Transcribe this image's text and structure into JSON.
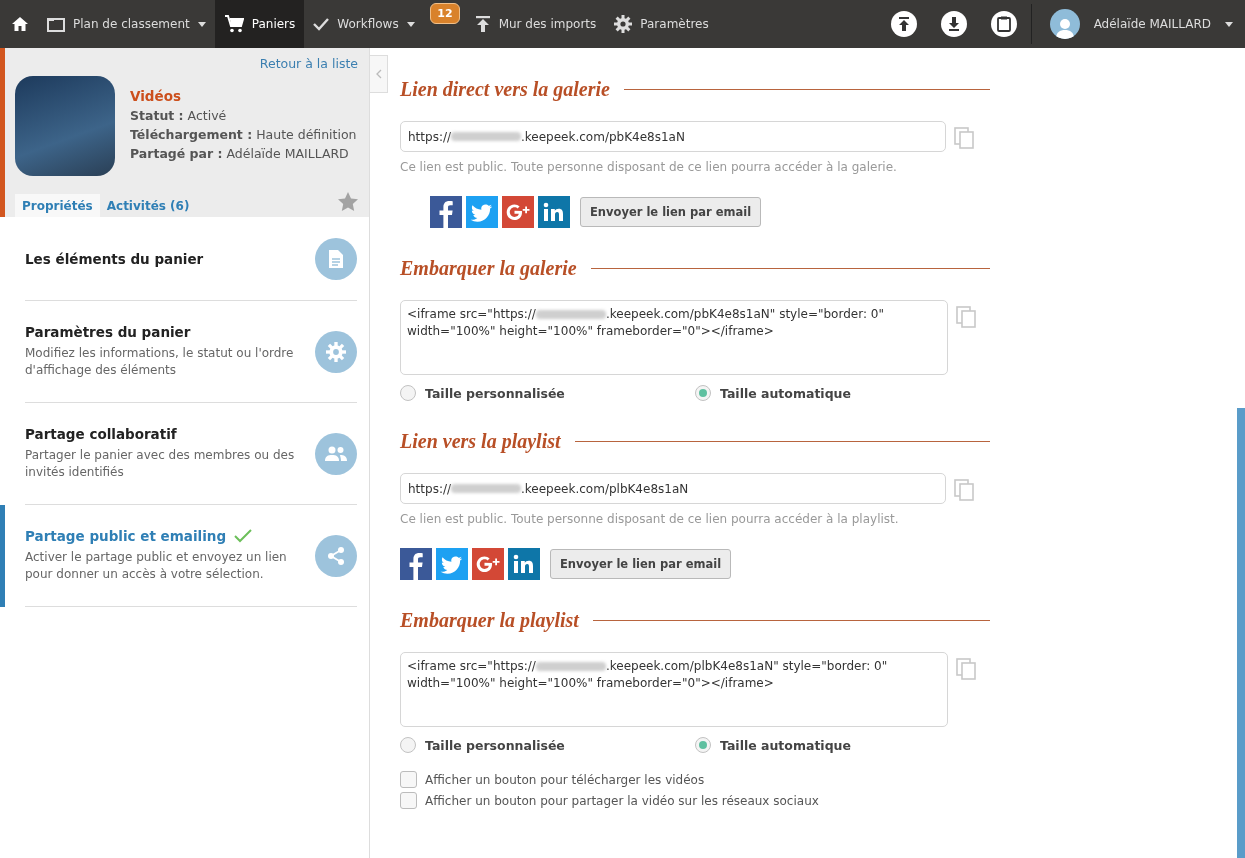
{
  "topbar": {
    "nav": [
      {
        "selected": false
      },
      {
        "label": "Plan de classement",
        "dropdown": true,
        "selected": false
      },
      {
        "label": "Paniers",
        "dropdown": false,
        "selected": true
      },
      {
        "label": "Workflows",
        "dropdown": true,
        "selected": false,
        "badge": "12"
      },
      {
        "label": "Mur des imports",
        "dropdown": false,
        "selected": false
      },
      {
        "label": "Paramètres",
        "dropdown": false,
        "selected": false
      }
    ],
    "user": {
      "name": "Adélaïde MAILLARD"
    }
  },
  "sidebar": {
    "back_link": "Retour à la liste",
    "basket": {
      "title": "Vidéos",
      "fields": [
        "**Statut :** Activé",
        "**Téléchargement :** Haute définition",
        "**Partagé par :** Adélaïde MAILLARD"
      ]
    },
    "tabs": [
      {
        "label": "Propriétés",
        "selected": true
      },
      {
        "label": "Activités (6)",
        "selected": false
      }
    ],
    "sections": [
      {
        "title": "Les éléments du panier",
        "selected": false,
        "done": false
      },
      {
        "title": "Paramètres du panier",
        "description": "Modifiez les informations, le statut ou l'ordre d'affichage des éléments",
        "selected": false,
        "done": false
      },
      {
        "title": "Partage collaboratif",
        "description": "Partager le panier avec des membres ou des invités identifiés",
        "selected": false,
        "done": false
      },
      {
        "title": "Partage public et emailing",
        "description": "Activer le partage public et envoyez un lien pour donner un accès à votre sélection.",
        "selected": true,
        "done": true
      }
    ]
  },
  "main": {
    "sections": [
      {
        "kind": "link",
        "heading": "Lien direct vers la galerie",
        "url": {
          "prefix": "https://",
          "suffix": ".keepeek.com/pbK4e8s1aN"
        },
        "note": "Ce lien est public. Toute personne disposant de ce lien pourra accéder à la galerie.",
        "indented": true,
        "email_button": "Envoyer le lien par email"
      },
      {
        "kind": "embed",
        "heading": "Embarquer la galerie",
        "code": {
          "prefix": "<iframe src=\"https://",
          "suffix": ".keepeek.com/pbK4e8s1aN\" style=\"border: 0\" width=\"100%\" height=\"100%\" frameborder=\"0\"></iframe>"
        },
        "size_options": [
          {
            "label": "Taille personnalisée",
            "selected": false
          },
          {
            "label": "Taille automatique",
            "selected": true
          }
        ]
      },
      {
        "kind": "link",
        "heading": "Lien vers la playlist",
        "url": {
          "prefix": "https://",
          "suffix": ".keepeek.com/plbK4e8s1aN"
        },
        "note": "Ce lien est public. Toute personne disposant de ce lien pourra accéder à la playlist.",
        "indented": false,
        "email_button": "Envoyer le lien par email"
      },
      {
        "kind": "embed",
        "heading": "Embarquer la playlist",
        "code": {
          "prefix": "<iframe src=\"https://",
          "suffix": ".keepeek.com/plbK4e8s1aN\" style=\"border: 0\" width=\"100%\" height=\"100%\" frameborder=\"0\"></iframe>"
        },
        "size_options": [
          {
            "label": "Taille personnalisée",
            "selected": false
          },
          {
            "label": "Taille automatique",
            "selected": true
          }
        ]
      }
    ],
    "options": [
      {
        "label": "Afficher un bouton pour télécharger les vidéos",
        "checked": false
      },
      {
        "label": "Afficher un bouton pour partager la vidéo sur les réseaux sociaux",
        "checked": false
      }
    ]
  }
}
